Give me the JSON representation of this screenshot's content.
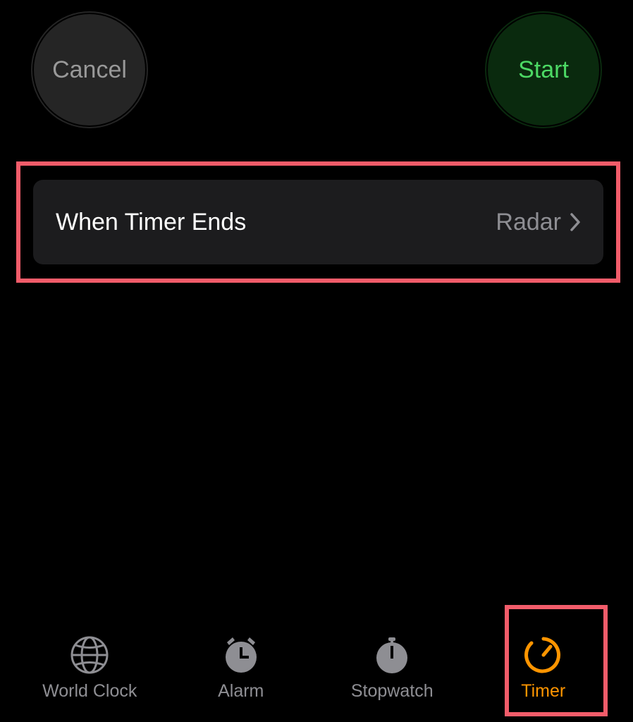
{
  "buttons": {
    "cancel": "Cancel",
    "start": "Start"
  },
  "timerEnds": {
    "label": "When Timer Ends",
    "value": "Radar"
  },
  "tabs": {
    "worldClock": "World Clock",
    "alarm": "Alarm",
    "stopwatch": "Stopwatch",
    "timer": "Timer"
  },
  "highlights": {
    "color": "#f25c6a"
  }
}
